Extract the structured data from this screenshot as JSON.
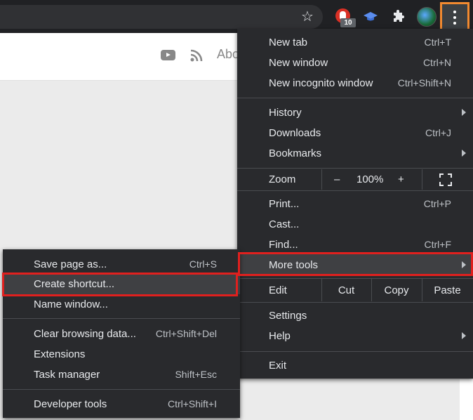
{
  "page": {
    "header_text": "Abo"
  },
  "main_menu": {
    "group1": [
      {
        "label": "New tab",
        "shortcut": "Ctrl+T"
      },
      {
        "label": "New window",
        "shortcut": "Ctrl+N"
      },
      {
        "label": "New incognito window",
        "shortcut": "Ctrl+Shift+N"
      }
    ],
    "group2": [
      {
        "label": "History",
        "shortcut": ""
      },
      {
        "label": "Downloads",
        "shortcut": "Ctrl+J"
      },
      {
        "label": "Bookmarks",
        "shortcut": ""
      }
    ],
    "zoom": {
      "label": "Zoom",
      "minus": "–",
      "value": "100%",
      "plus": "+"
    },
    "group3": [
      {
        "label": "Print...",
        "shortcut": "Ctrl+P"
      },
      {
        "label": "Cast...",
        "shortcut": ""
      },
      {
        "label": "Find...",
        "shortcut": "Ctrl+F"
      },
      {
        "label": "More tools",
        "shortcut": ""
      }
    ],
    "edit": {
      "label": "Edit",
      "cut": "Cut",
      "copy": "Copy",
      "paste": "Paste"
    },
    "group4": [
      {
        "label": "Settings"
      },
      {
        "label": "Help"
      }
    ],
    "exit": "Exit"
  },
  "sub_menu": {
    "group1": [
      {
        "label": "Save page as...",
        "shortcut": "Ctrl+S"
      },
      {
        "label": "Create shortcut...",
        "shortcut": ""
      },
      {
        "label": "Name window...",
        "shortcut": ""
      }
    ],
    "group2": [
      {
        "label": "Clear browsing data...",
        "shortcut": "Ctrl+Shift+Del"
      },
      {
        "label": "Extensions",
        "shortcut": ""
      },
      {
        "label": "Task manager",
        "shortcut": "Shift+Esc"
      }
    ],
    "group3": [
      {
        "label": "Developer tools",
        "shortcut": "Ctrl+Shift+I"
      }
    ]
  },
  "toolbar": {
    "extension_badge": "10",
    "icons": [
      "star-icon",
      "stop-hand-extension-icon",
      "graduation-cap-extension-icon",
      "puzzle-extensions-icon",
      "profile-avatar",
      "menu-kebab-icon"
    ]
  },
  "colors": {
    "menu_bg": "#292a2d",
    "highlight": "#3f4043",
    "annotation_red": "#e0201e",
    "annotation_orange": "#f28a30"
  }
}
